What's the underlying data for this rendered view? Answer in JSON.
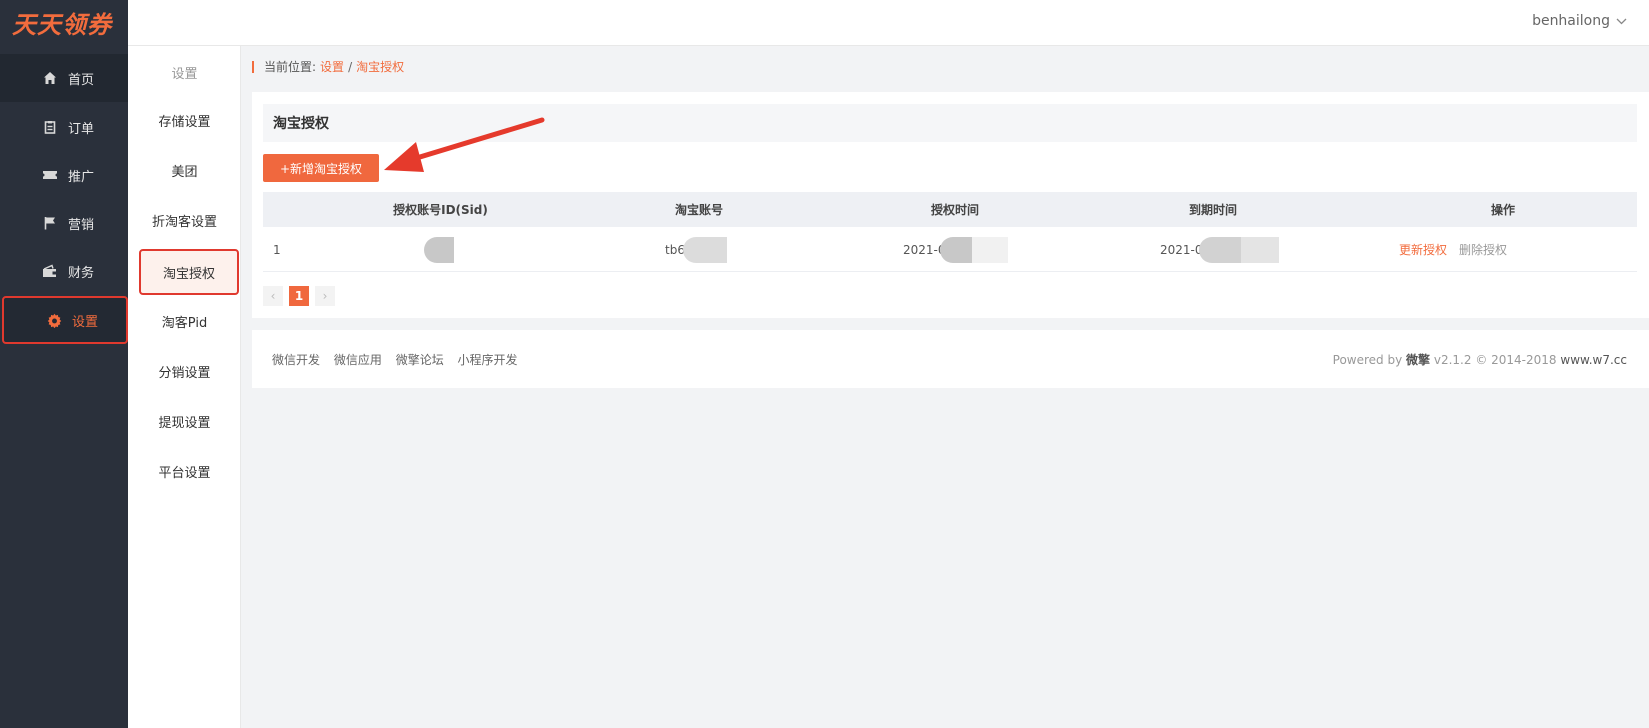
{
  "app": {
    "logo": "天天领券"
  },
  "header": {
    "username": "benhailong"
  },
  "sidebar": {
    "items": [
      {
        "label": "首页",
        "icon": "home-icon"
      },
      {
        "label": "订单",
        "icon": "clipboard-icon"
      },
      {
        "label": "推广",
        "icon": "ticket-icon"
      },
      {
        "label": "营销",
        "icon": "flag-icon"
      },
      {
        "label": "财务",
        "icon": "wallet-icon"
      },
      {
        "label": "设置",
        "icon": "gear-icon"
      }
    ]
  },
  "subnav": {
    "title": "设置",
    "items": [
      "存储设置",
      "美团",
      "折淘客设置",
      "淘宝授权",
      "淘客Pid",
      "分销设置",
      "提现设置",
      "平台设置"
    ]
  },
  "breadcrumb": {
    "prefix": "当前位置:",
    "level1": "设置",
    "sep": "/",
    "level2": "淘宝授权"
  },
  "main": {
    "title": "淘宝授权",
    "add_button": "+新增淘宝授权",
    "columns": [
      "授权账号ID(Sid)",
      "淘宝账号",
      "授权时间",
      "到期时间",
      "操作"
    ],
    "rows": [
      {
        "index": "1",
        "account": "tb6",
        "auth_time": "2021-0",
        "expire_time": "2021-0",
        "update_label": "更新授权",
        "delete_label": "删除授权"
      }
    ],
    "pager": {
      "prev": "‹",
      "current": "1",
      "next": "›"
    }
  },
  "footer": {
    "links": [
      "微信开发",
      "微信应用",
      "微擎论坛",
      "小程序开发"
    ],
    "powered_prefix": "Powered by",
    "brand": "微擎",
    "version": "v2.1.2 © 2014-2018",
    "site": "www.w7.cc"
  },
  "colors": {
    "accent": "#f26c3d",
    "sidebar_bg": "#2a303b",
    "highlight": "#e0392e"
  }
}
